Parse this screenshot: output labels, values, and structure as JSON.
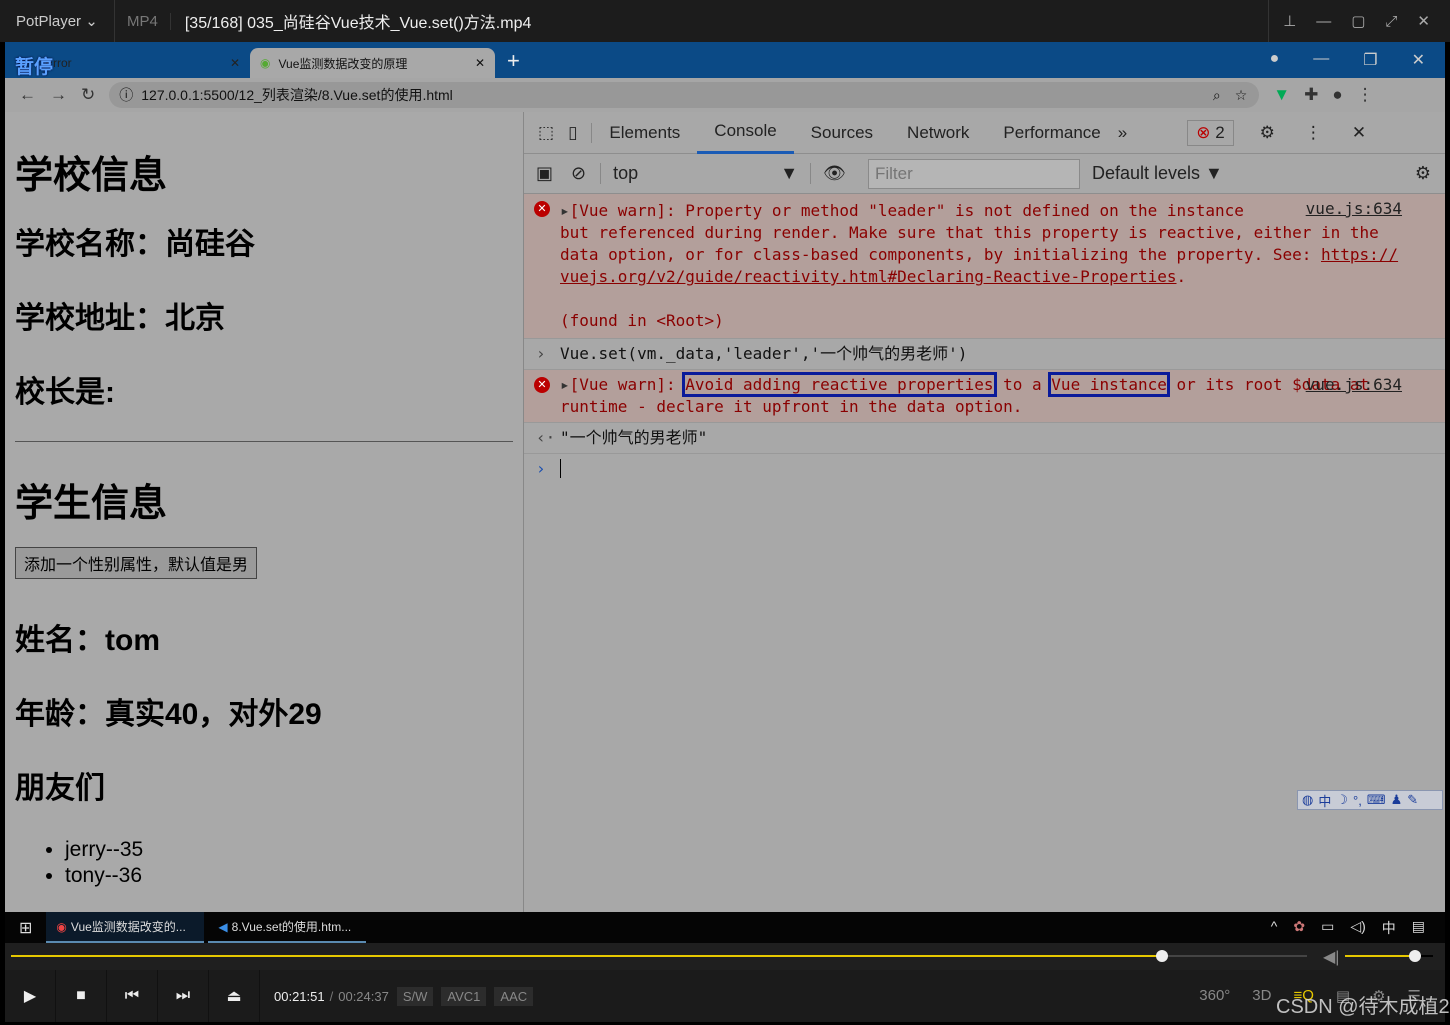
{
  "player": {
    "app": "PotPlayer",
    "format": "MP4",
    "title": "[35/168] 035_尚硅谷Vue技术_Vue.set()方法.mp4",
    "paused_label": "暂停",
    "current_time": "00:21:51",
    "total_time": "00:24:37",
    "badges": [
      "S/W",
      "AVC1",
      "AAC"
    ],
    "progress_percent": 88.8,
    "volume_percent": 80,
    "accent": "#e6c800"
  },
  "browser": {
    "tabs": [
      {
        "label": "Error"
      },
      {
        "label": "Vue监测数据改变的原理"
      }
    ],
    "url": "127.0.0.1:5500/12_列表渲染/8.Vue.set的使用.html"
  },
  "page": {
    "school_title": "学校信息",
    "school_name": "学校名称：尚硅谷",
    "school_addr": "学校地址：北京",
    "leader": "校长是:",
    "student_title": "学生信息",
    "add_button": "添加一个性别属性，默认值是男",
    "name": "姓名：tom",
    "age": "年龄：真实40，对外29",
    "friends_title": "朋友们",
    "friends": [
      "jerry--35",
      "tony--36"
    ]
  },
  "devtools": {
    "tabs": [
      "Elements",
      "Console",
      "Sources",
      "Network",
      "Performance"
    ],
    "error_count": "2",
    "context": "top",
    "filter_placeholder": "Filter",
    "levels": "Default levels",
    "log": {
      "err1_head": "[Vue warn]: Property or method \"leader\" is not defined on the instance",
      "err1_body": "but referenced during render. Make sure that this property is reactive, either in the data option, or for class-based components, by initializing the property. See: ",
      "err1_link": "https://vuejs.org/v2/guide/reactivity.html#Declaring-Reactive-Properties",
      "err1_found": "(found in <Root>)",
      "source": "vue.js:634",
      "input": "Vue.set(vm._data,'leader','一个帅气的男老师')",
      "err2_a": "[Vue warn]:",
      "err2_b": "Avoid adding reactive properties",
      "err2_c": " to a ",
      "err2_d": "Vue instance",
      "err2_e": " or its root $data at runtime - declare it upfront in the data option.",
      "result": "\"一个帅气的男老师\""
    }
  },
  "ime": "中",
  "taskbar": {
    "items": [
      "Vue监测数据改变的...",
      "8.Vue.set的使用.htm..."
    ],
    "tray_lang": "中"
  },
  "watermark": "CSDN @待木成植2"
}
